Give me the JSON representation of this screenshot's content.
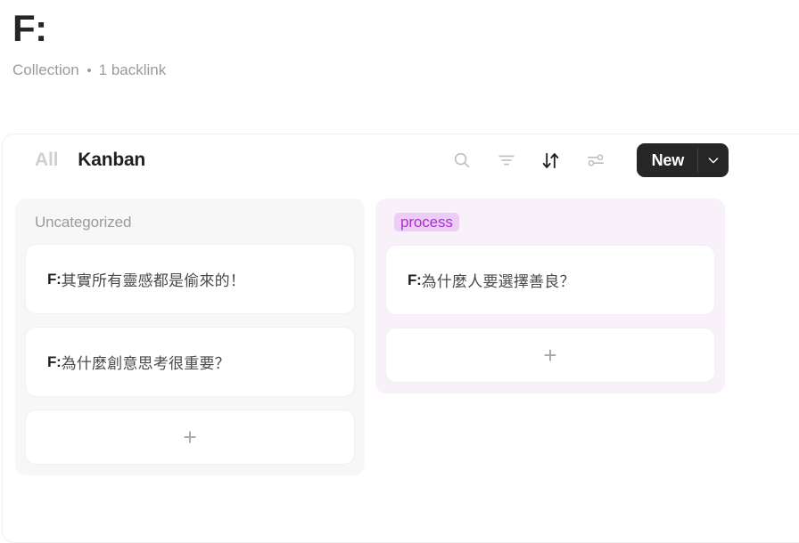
{
  "header": {
    "title": "F:",
    "meta_type": "Collection",
    "meta_backlinks": "1 backlink"
  },
  "toolbar": {
    "tabs": [
      {
        "label": "All",
        "active": false
      },
      {
        "label": "Kanban",
        "active": true
      }
    ],
    "icons": [
      {
        "name": "search-icon"
      },
      {
        "name": "filter-icon"
      },
      {
        "name": "sort-icon"
      },
      {
        "name": "settings-sliders-icon"
      }
    ],
    "new_label": "New",
    "new_caret_icon": "chevron-down-icon",
    "accent_dark": "#262626"
  },
  "board": {
    "columns": [
      {
        "id": "uncategorized",
        "title": "Uncategorized",
        "title_style": "plain",
        "background": "#f7f7f8",
        "cards": [
          {
            "prefix": "F:",
            "text": "其實所有靈感都是偷來的！"
          },
          {
            "prefix": "F:",
            "text": "為什麼創意思考很重要？"
          }
        ],
        "add_card_glyph": "+"
      },
      {
        "id": "process",
        "title": "process",
        "title_style": "badge",
        "background": "#f8f1fa",
        "badge_bg": "#eccdf3",
        "badge_fg": "#a534c9",
        "cards": [
          {
            "prefix": "F:",
            "text": "為什麼人要選擇善良？"
          }
        ],
        "add_card_glyph": "+"
      }
    ]
  }
}
